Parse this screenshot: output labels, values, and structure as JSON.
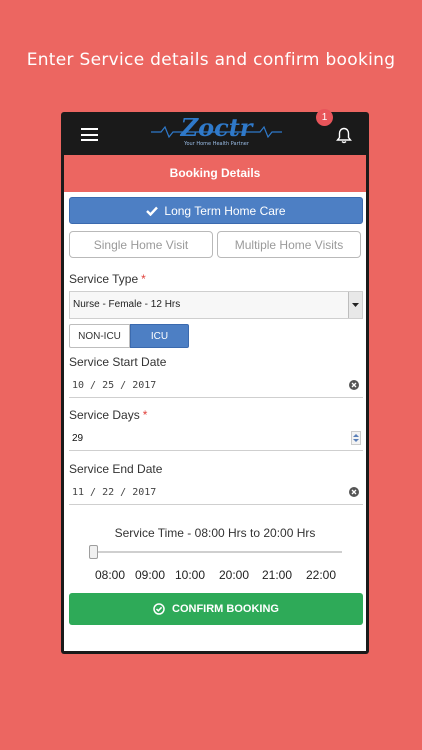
{
  "headline": "Enter Service details and confirm booking",
  "appbar": {
    "logo_text": "Zoctr",
    "logo_tagline": "Your Home Health Partner",
    "notification_count": "1"
  },
  "section_title": "Booking Details",
  "care_type": {
    "label": "Long Term Home Care",
    "icon": "check-icon"
  },
  "visit_options": [
    "Single Home Visit",
    "Multiple Home Visits"
  ],
  "service_type": {
    "label": "Service Type",
    "required_mark": "*",
    "value": "Nurse - Female - 12 Hrs"
  },
  "care_level": {
    "options": [
      "NON-ICU",
      "ICU"
    ],
    "selected": "ICU"
  },
  "start_date": {
    "label": "Service Start Date",
    "value": "10 / 25 / 2017"
  },
  "service_days": {
    "label": "Service Days",
    "required_mark": "*",
    "value": "29"
  },
  "end_date": {
    "label": "Service End Date",
    "value": "11 / 22 / 2017"
  },
  "service_time": {
    "label": "Service Time -  08:00 Hrs to 20:00 Hrs",
    "ticks": [
      "08:00",
      "09:00",
      "10:00",
      "20:00",
      "21:00",
      "22:00"
    ],
    "slider_value": "08:00"
  },
  "confirm_button": "CONFIRM BOOKING",
  "colors": {
    "page_bg": "#ec6661",
    "primary_blue": "#4d7fc4",
    "confirm_green": "#2eaa58",
    "header_red": "#ec6661"
  }
}
